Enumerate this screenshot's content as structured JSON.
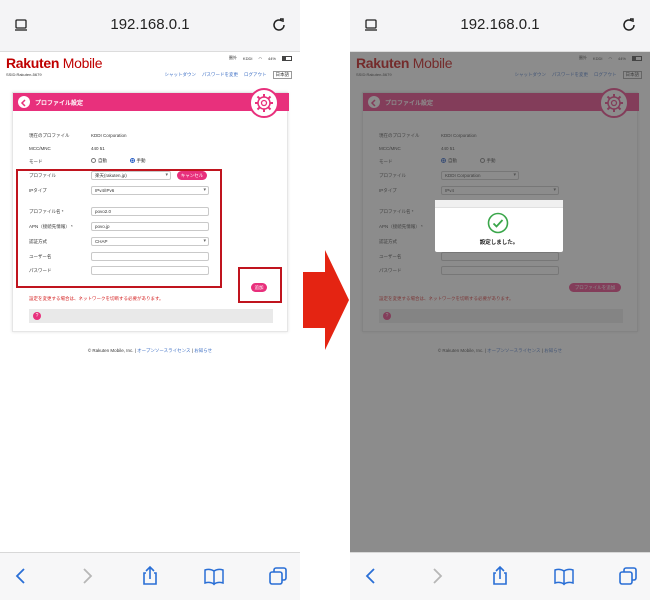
{
  "url": "192.168.0.1",
  "header": {
    "logo_main": "Rakuten",
    "logo_sub": "Mobile",
    "ssid": "SSID:Rakuten-5679",
    "status_items": [
      "圏外",
      "KDDI",
      "44%"
    ],
    "links": [
      "シャットダウン",
      "パスワードを変更",
      "ログアウト"
    ],
    "language": "日本語"
  },
  "card": {
    "title": "プロファイル設定",
    "current_profile_label": "現在のプロファイル",
    "current_profile_value": "KDDI Corporation",
    "mcc_label": "MCC/MNC",
    "mcc_value": "440 51",
    "mode_label": "モード",
    "mode_auto": "自動",
    "mode_manual": "手動",
    "profile_label": "プロファイル",
    "profile_value_left": "楽天(rakuten.jp)",
    "profile_value_right": "KDDI Corporation",
    "cancel_button": "キャンセル",
    "iptype_label": "IPタイプ",
    "iptype_value_left": "IPv4/IPv6",
    "iptype_value_right": "IPv4",
    "profile_name_label": "プロファイル名 *",
    "profile_name_value": "povo2.0",
    "apn_label": "APN（接続先情報） *",
    "apn_value": "povo.jp",
    "auth_label": "認証方式",
    "auth_value": "CHAP",
    "username_label": "ユーザー名",
    "password_label": "パスワード",
    "save_button": "追加",
    "add_button_right": "プロファイルを追加",
    "warning": "設定を変更する場合は、ネットワークを切断する必要があります。",
    "help_icon": "?"
  },
  "footer": {
    "copyright": "© Rakuten Mobile, Inc.",
    "license_link": "オープンソースライセンス",
    "notice_link": "お知らせ"
  },
  "dialog": {
    "message": "設定しました。"
  },
  "colors": {
    "brand_pink": "#e8307c",
    "rakuten_red": "#bf0000",
    "highlight_red": "#c0141e",
    "link_blue": "#3a6dc4",
    "warning_red": "#d42020",
    "check_green": "#3aa64a"
  },
  "icons": [
    "page-icon",
    "reload-icon",
    "back-icon",
    "forward-icon",
    "share-icon",
    "bookmarks-icon",
    "tabs-icon",
    "gear-icon",
    "chevron-left-icon",
    "check-icon",
    "help-icon",
    "right-arrow-icon"
  ]
}
